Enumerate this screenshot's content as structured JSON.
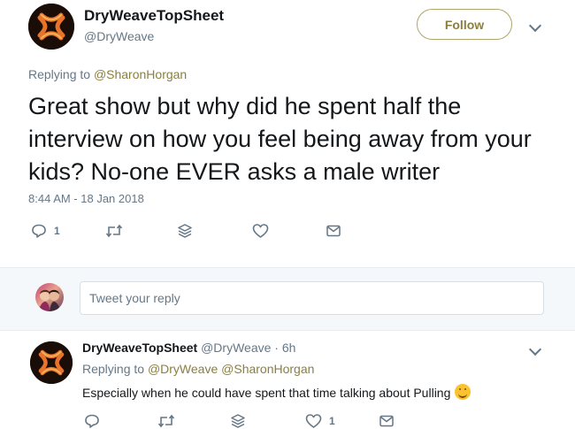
{
  "tweet": {
    "display_name": "DryWeaveTopSheet",
    "handle": "@DryWeave",
    "follow_label": "Follow",
    "replying_prefix": "Replying to",
    "replying_to": "@SharonHorgan",
    "text": "Great show but why did he spent half the interview on how you feel being away from your kids? No-one EVER asks a male writer",
    "timestamp": "8:44 AM - 18 Jan 2018",
    "reply_count": "1",
    "like_count": ""
  },
  "compose": {
    "placeholder": "Tweet your reply"
  },
  "reply": {
    "display_name": "DryWeaveTopSheet",
    "handle": "@DryWeave",
    "separator": "·",
    "time": "6h",
    "replying_prefix": "Replying to",
    "replying_to_1": "@DryWeave",
    "replying_to_2": "@SharonHorgan",
    "text": "Especially when he could have spent that time talking about Pulling",
    "reply_count": "",
    "like_count": "1"
  },
  "icons": {
    "reply": "reply-icon",
    "retweet": "retweet-icon",
    "stack": "stack-icon",
    "like": "heart-icon",
    "message": "envelope-icon",
    "chevron": "chevron-down-icon",
    "emoji": "smiling-face-icon"
  },
  "colors": {
    "accent": "#8a7f3f",
    "muted": "#657786",
    "text": "#14171a",
    "band": "#f5f8fa"
  }
}
